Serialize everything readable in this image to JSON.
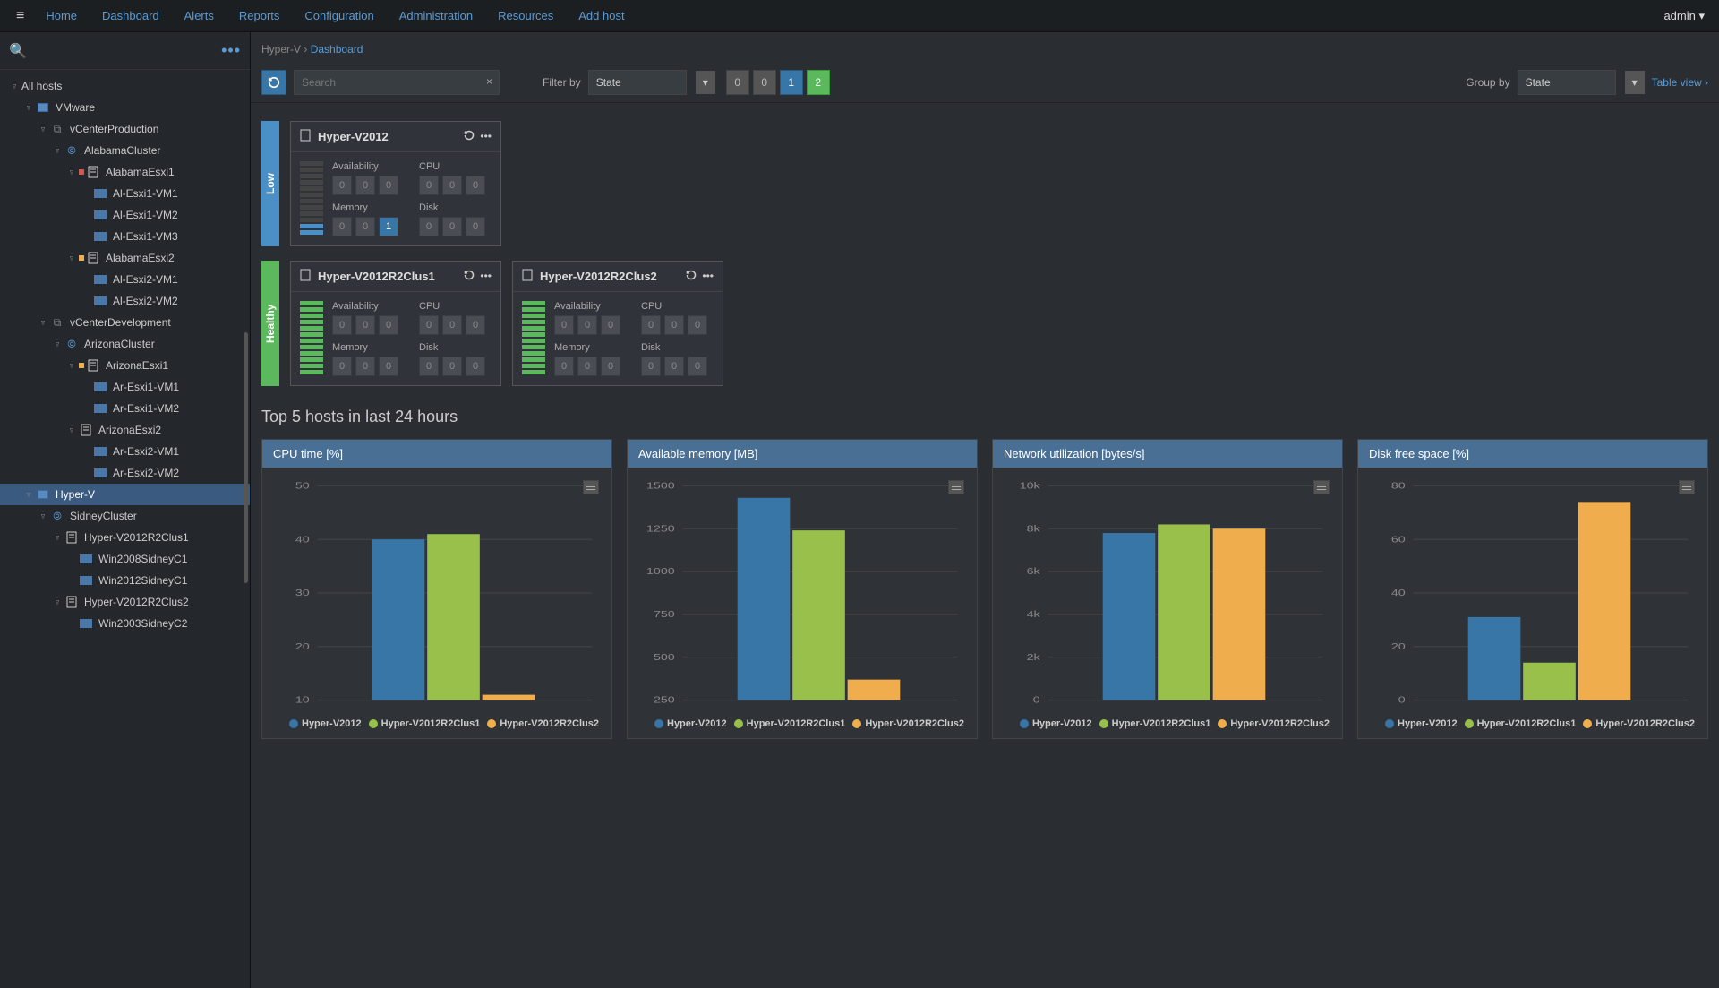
{
  "topbar": {
    "nav": [
      "Home",
      "Dashboard",
      "Alerts",
      "Reports",
      "Configuration",
      "Administration",
      "Resources",
      "Add host"
    ],
    "user": "admin ▾"
  },
  "sidebar": {
    "root": "All hosts",
    "tree": [
      {
        "l": "VMware",
        "d": 1,
        "t": "folder"
      },
      {
        "l": "vCenterProduction",
        "d": 2,
        "t": "vc"
      },
      {
        "l": "AlabamaCluster",
        "d": 3,
        "t": "cluster"
      },
      {
        "l": "AlabamaEsxi1",
        "d": 4,
        "t": "host",
        "dot": "red"
      },
      {
        "l": "Al-Esxi1-VM1",
        "d": 5,
        "t": "vm"
      },
      {
        "l": "Al-Esxi1-VM2",
        "d": 5,
        "t": "vm"
      },
      {
        "l": "Al-Esxi1-VM3",
        "d": 5,
        "t": "vm"
      },
      {
        "l": "AlabamaEsxi2",
        "d": 4,
        "t": "host",
        "dot": "yellow"
      },
      {
        "l": "Al-Esxi2-VM1",
        "d": 5,
        "t": "vm"
      },
      {
        "l": "Al-Esxi2-VM2",
        "d": 5,
        "t": "vm"
      },
      {
        "l": "vCenterDevelopment",
        "d": 2,
        "t": "vc"
      },
      {
        "l": "ArizonaCluster",
        "d": 3,
        "t": "cluster"
      },
      {
        "l": "ArizonaEsxi1",
        "d": 4,
        "t": "host",
        "dot": "yellow"
      },
      {
        "l": "Ar-Esxi1-VM1",
        "d": 5,
        "t": "vm"
      },
      {
        "l": "Ar-Esxi1-VM2",
        "d": 5,
        "t": "vm"
      },
      {
        "l": "ArizonaEsxi2",
        "d": 4,
        "t": "host"
      },
      {
        "l": "Ar-Esxi2-VM1",
        "d": 5,
        "t": "vm"
      },
      {
        "l": "Ar-Esxi2-VM2",
        "d": 5,
        "t": "vm"
      },
      {
        "l": "Hyper-V",
        "d": 1,
        "t": "folder",
        "sel": true
      },
      {
        "l": "SidneyCluster",
        "d": 2,
        "t": "cluster"
      },
      {
        "l": "Hyper-V2012R2Clus1",
        "d": 3,
        "t": "host"
      },
      {
        "l": "Win2008SidneyC1",
        "d": 4,
        "t": "vm"
      },
      {
        "l": "Win2012SidneyC1",
        "d": 4,
        "t": "vm"
      },
      {
        "l": "Hyper-V2012R2Clus2",
        "d": 3,
        "t": "host"
      },
      {
        "l": "Win2003SidneyC2",
        "d": 4,
        "t": "vm"
      }
    ]
  },
  "breadcrumb": {
    "root": "Hyper-V",
    "leaf": "Dashboard"
  },
  "toolbar": {
    "search_placeholder": "Search",
    "filter_label": "Filter by",
    "filter_value": "State",
    "counts": [
      {
        "v": "0",
        "cls": ""
      },
      {
        "v": "0",
        "cls": ""
      },
      {
        "v": "1",
        "cls": "blue"
      },
      {
        "v": "2",
        "cls": "green"
      }
    ],
    "group_label": "Group by",
    "group_value": "State",
    "view_link": "Table view"
  },
  "status_rows": [
    {
      "status": "Low",
      "cls": "low",
      "hosts": [
        {
          "name": "Hyper-V2012",
          "bars": "blue",
          "metrics": {
            "Availability": [
              "0",
              "0",
              "0"
            ],
            "CPU": [
              "0",
              "0",
              "0"
            ],
            "Memory": [
              "0",
              "0",
              {
                "v": "1",
                "cls": "blue"
              }
            ],
            "Disk": [
              "0",
              "0",
              "0"
            ]
          }
        }
      ]
    },
    {
      "status": "Healthy",
      "cls": "healthy",
      "hosts": [
        {
          "name": "Hyper-V2012R2Clus1",
          "bars": "green",
          "metrics": {
            "Availability": [
              "0",
              "0",
              "0"
            ],
            "CPU": [
              "0",
              "0",
              "0"
            ],
            "Memory": [
              "0",
              "0",
              "0"
            ],
            "Disk": [
              "0",
              "0",
              "0"
            ]
          }
        },
        {
          "name": "Hyper-V2012R2Clus2",
          "bars": "green",
          "metrics": {
            "Availability": [
              "0",
              "0",
              "0"
            ],
            "CPU": [
              "0",
              "0",
              "0"
            ],
            "Memory": [
              "0",
              "0",
              "0"
            ],
            "Disk": [
              "0",
              "0",
              "0"
            ]
          }
        }
      ]
    }
  ],
  "section_title": "Top 5 hosts in last 24 hours",
  "colors": [
    "#3876a8",
    "#9ac04c",
    "#f0ad4e"
  ],
  "legend_names": [
    "Hyper-V2012",
    "Hyper-V2012R2Clus1",
    "Hyper-V2012R2Clus2"
  ],
  "chart_data": [
    {
      "type": "bar",
      "title": "CPU time [%]",
      "ymin": 10,
      "ymax": 50,
      "ticks": [
        10,
        20,
        30,
        40,
        50
      ],
      "series": [
        {
          "name": "Hyper-V2012",
          "value": 40
        },
        {
          "name": "Hyper-V2012R2Clus1",
          "value": 41
        },
        {
          "name": "Hyper-V2012R2Clus2",
          "value": 11
        }
      ]
    },
    {
      "type": "bar",
      "title": "Available memory [MB]",
      "ymin": 250,
      "ymax": 1500,
      "ticks": [
        250,
        500,
        750,
        1000,
        1250,
        1500
      ],
      "series": [
        {
          "name": "Hyper-V2012",
          "value": 1430
        },
        {
          "name": "Hyper-V2012R2Clus1",
          "value": 1240
        },
        {
          "name": "Hyper-V2012R2Clus2",
          "value": 370
        }
      ]
    },
    {
      "type": "bar",
      "title": "Network utilization [bytes/s]",
      "ymin": 0,
      "ymax": 10000,
      "ticks": [
        0,
        2000,
        4000,
        6000,
        8000,
        10000
      ],
      "tick_labels": [
        "0",
        "2k",
        "4k",
        "6k",
        "8k",
        "10k"
      ],
      "series": [
        {
          "name": "Hyper-V2012",
          "value": 7800
        },
        {
          "name": "Hyper-V2012R2Clus1",
          "value": 8200
        },
        {
          "name": "Hyper-V2012R2Clus2",
          "value": 8000
        }
      ]
    },
    {
      "type": "bar",
      "title": "Disk free space [%]",
      "ymin": 0,
      "ymax": 80,
      "ticks": [
        0,
        20,
        40,
        60,
        80
      ],
      "series": [
        {
          "name": "Hyper-V2012",
          "value": 31
        },
        {
          "name": "Hyper-V2012R2Clus1",
          "value": 14
        },
        {
          "name": "Hyper-V2012R2Clus2",
          "value": 74
        }
      ]
    }
  ]
}
